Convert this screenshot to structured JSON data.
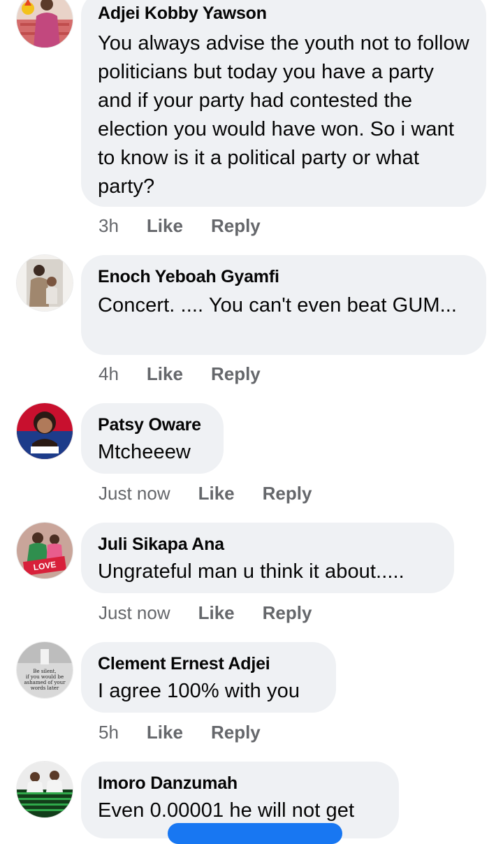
{
  "colors": {
    "bubble": "#eff1f4",
    "secondary_text": "#65676b",
    "primary_text": "#050505",
    "accent": "#1877f2"
  },
  "comments": [
    {
      "author": "Adjei Kobby Yawson",
      "text": "You always advise the youth not to follow politicians but today you have a party and if your party had contested the election you would have won. So i want to know is it a political party or what party?",
      "time": "3h",
      "like": "Like",
      "reply": "Reply"
    },
    {
      "author": "Enoch Yeboah Gyamfi",
      "text": "Concert. .... You can't even beat GUM...",
      "time": "4h",
      "like": "Like",
      "reply": "Reply"
    },
    {
      "author": "Patsy Oware",
      "text": "Mtcheeew",
      "time": "Just now",
      "like": "Like",
      "reply": "Reply"
    },
    {
      "author": "Juli Sikapa Ana",
      "text": "Ungrateful man u think it about.....",
      "time": "Just now",
      "like": "Like",
      "reply": "Reply"
    },
    {
      "author": "Clement Ernest Adjei",
      "text": "I agree 100% with you",
      "time": "5h",
      "like": "Like",
      "reply": "Reply"
    },
    {
      "author": "Imoro Danzumah",
      "text": "Even 0.00001 he will not get"
    }
  ],
  "avatar_images": {
    "clement_quote": [
      "Be silent,",
      "if you would be",
      "ashamed of your",
      "words later"
    ],
    "juli_love": "LOVE"
  }
}
